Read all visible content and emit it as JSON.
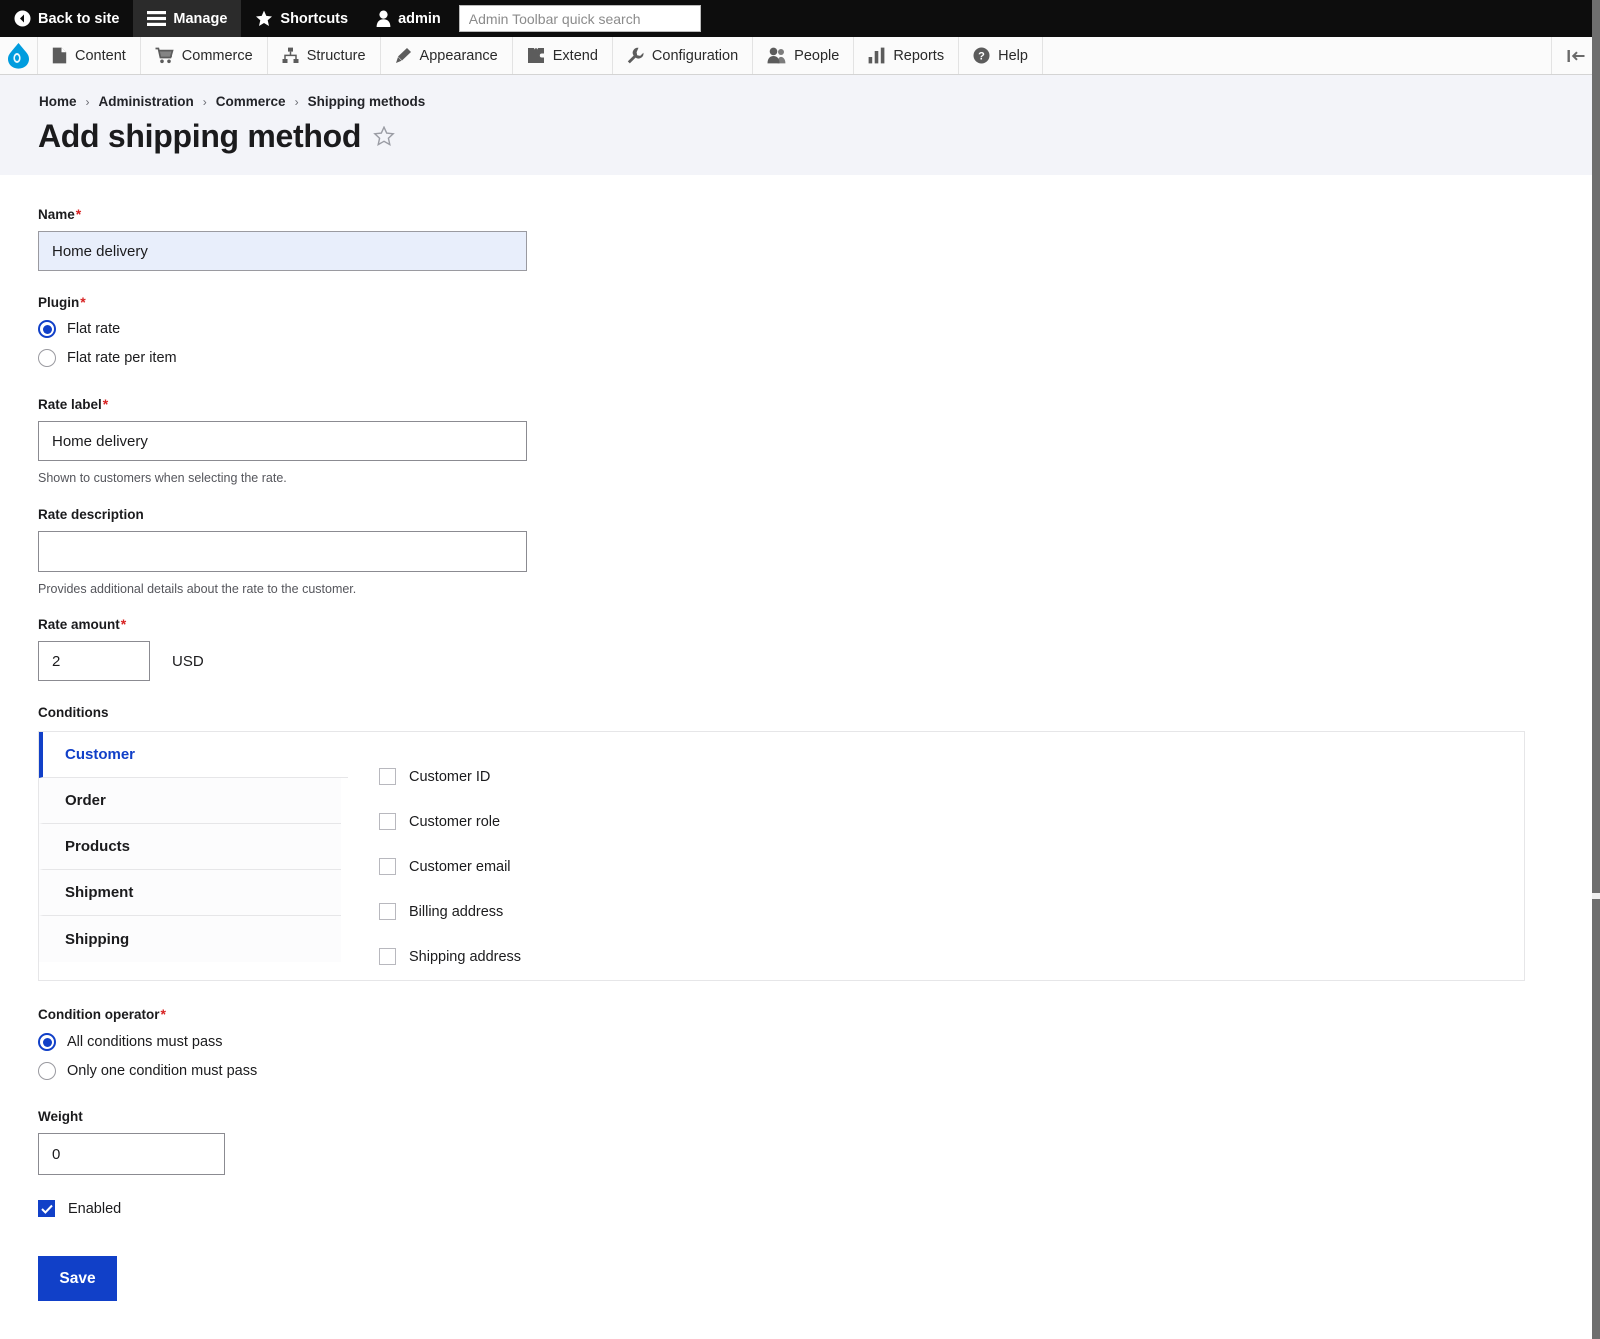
{
  "toolbar": {
    "back_to_site": "Back to site",
    "manage": "Manage",
    "shortcuts": "Shortcuts",
    "user": "admin",
    "search_placeholder": "Admin Toolbar quick search",
    "active_tab": "Manage"
  },
  "menu": {
    "items": [
      {
        "label": "Content",
        "icon": "document-icon"
      },
      {
        "label": "Commerce",
        "icon": "cart-icon"
      },
      {
        "label": "Structure",
        "icon": "sitemap-icon"
      },
      {
        "label": "Appearance",
        "icon": "paintbrush-icon"
      },
      {
        "label": "Extend",
        "icon": "puzzle-icon"
      },
      {
        "label": "Configuration",
        "icon": "wrench-icon"
      },
      {
        "label": "People",
        "icon": "people-icon"
      },
      {
        "label": "Reports",
        "icon": "bar-chart-icon"
      },
      {
        "label": "Help",
        "icon": "question-circle-icon"
      }
    ]
  },
  "breadcrumb": [
    "Home",
    "Administration",
    "Commerce",
    "Shipping methods"
  ],
  "page": {
    "title": "Add shipping method"
  },
  "form": {
    "name": {
      "label": "Name",
      "required": true,
      "value": "Home delivery"
    },
    "plugin": {
      "label": "Plugin",
      "required": true,
      "options": [
        "Flat rate",
        "Flat rate per item"
      ],
      "selected": "Flat rate"
    },
    "rate_label": {
      "label": "Rate label",
      "required": true,
      "value": "Home delivery",
      "description": "Shown to customers when selecting the rate."
    },
    "rate_description": {
      "label": "Rate description",
      "required": false,
      "value": "",
      "description": "Provides additional details about the rate to the customer."
    },
    "rate_amount": {
      "label": "Rate amount",
      "required": true,
      "value": "2",
      "currency": "USD"
    },
    "conditions": {
      "label": "Conditions",
      "tabs": [
        "Customer",
        "Order",
        "Products",
        "Shipment",
        "Shipping"
      ],
      "active_tab": "Customer",
      "items": [
        {
          "label": "Customer ID",
          "checked": false
        },
        {
          "label": "Customer role",
          "checked": false
        },
        {
          "label": "Customer email",
          "checked": false
        },
        {
          "label": "Billing address",
          "checked": false
        },
        {
          "label": "Shipping address",
          "checked": false
        }
      ]
    },
    "condition_operator": {
      "label": "Condition operator",
      "required": true,
      "options": [
        "All conditions must pass",
        "Only one condition must pass"
      ],
      "selected": "All conditions must pass"
    },
    "weight": {
      "label": "Weight",
      "required": false,
      "value": "0"
    },
    "enabled": {
      "label": "Enabled",
      "checked": true
    },
    "save_label": "Save"
  },
  "colors": {
    "accent": "#1140c8",
    "toolbar_bg": "#0d0d0d",
    "header_band": "#f3f4f9",
    "required_star": "#d72222",
    "drupal_blue": "#009cde"
  }
}
